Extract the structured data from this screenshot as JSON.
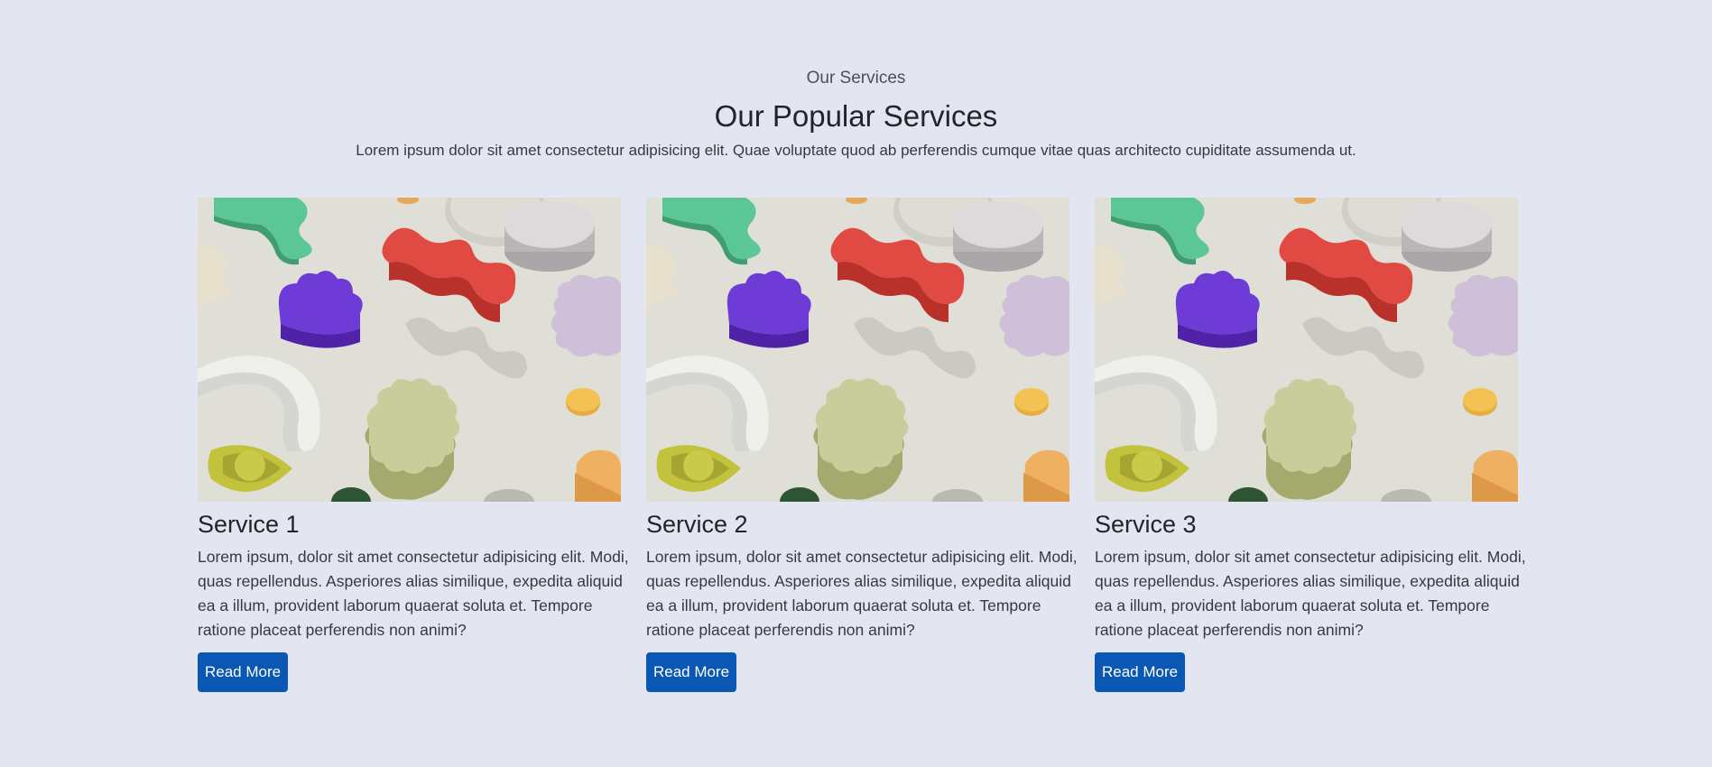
{
  "header": {
    "eyebrow": "Our Services",
    "title": "Our Popular Services",
    "lead": "Lorem ipsum dolor sit amet consectetur adipisicing elit. Quae voluptate quod ab perferendis cumque vitae quas architecto cupiditate assumenda ut."
  },
  "cards": [
    {
      "title": "Service 1",
      "text": "Lorem ipsum, dolor sit amet consectetur adipisicing elit. Modi, quas repellendus. Asperiores alias similique, expedita aliquid ea a illum, provident laborum quaerat soluta et. Tempore ratione placeat perferendis non animi?",
      "button": "Read More"
    },
    {
      "title": "Service 2",
      "text": "Lorem ipsum, dolor sit amet consectetur adipisicing elit. Modi, quas repellendus. Asperiores alias similique, expedita aliquid ea a illum, provident laborum quaerat soluta et. Tempore ratione placeat perferendis non animi?",
      "button": "Read More"
    },
    {
      "title": "Service 3",
      "text": "Lorem ipsum, dolor sit amet consectetur adipisicing elit. Modi, quas repellendus. Asperiores alias similique, expedita aliquid ea a illum, provident laborum quaerat soluta et. Tempore ratione placeat perferendis non animi?",
      "button": "Read More"
    }
  ],
  "colors": {
    "background": "#e3e6f1",
    "button": "#0a58b4",
    "text": "#212529"
  }
}
